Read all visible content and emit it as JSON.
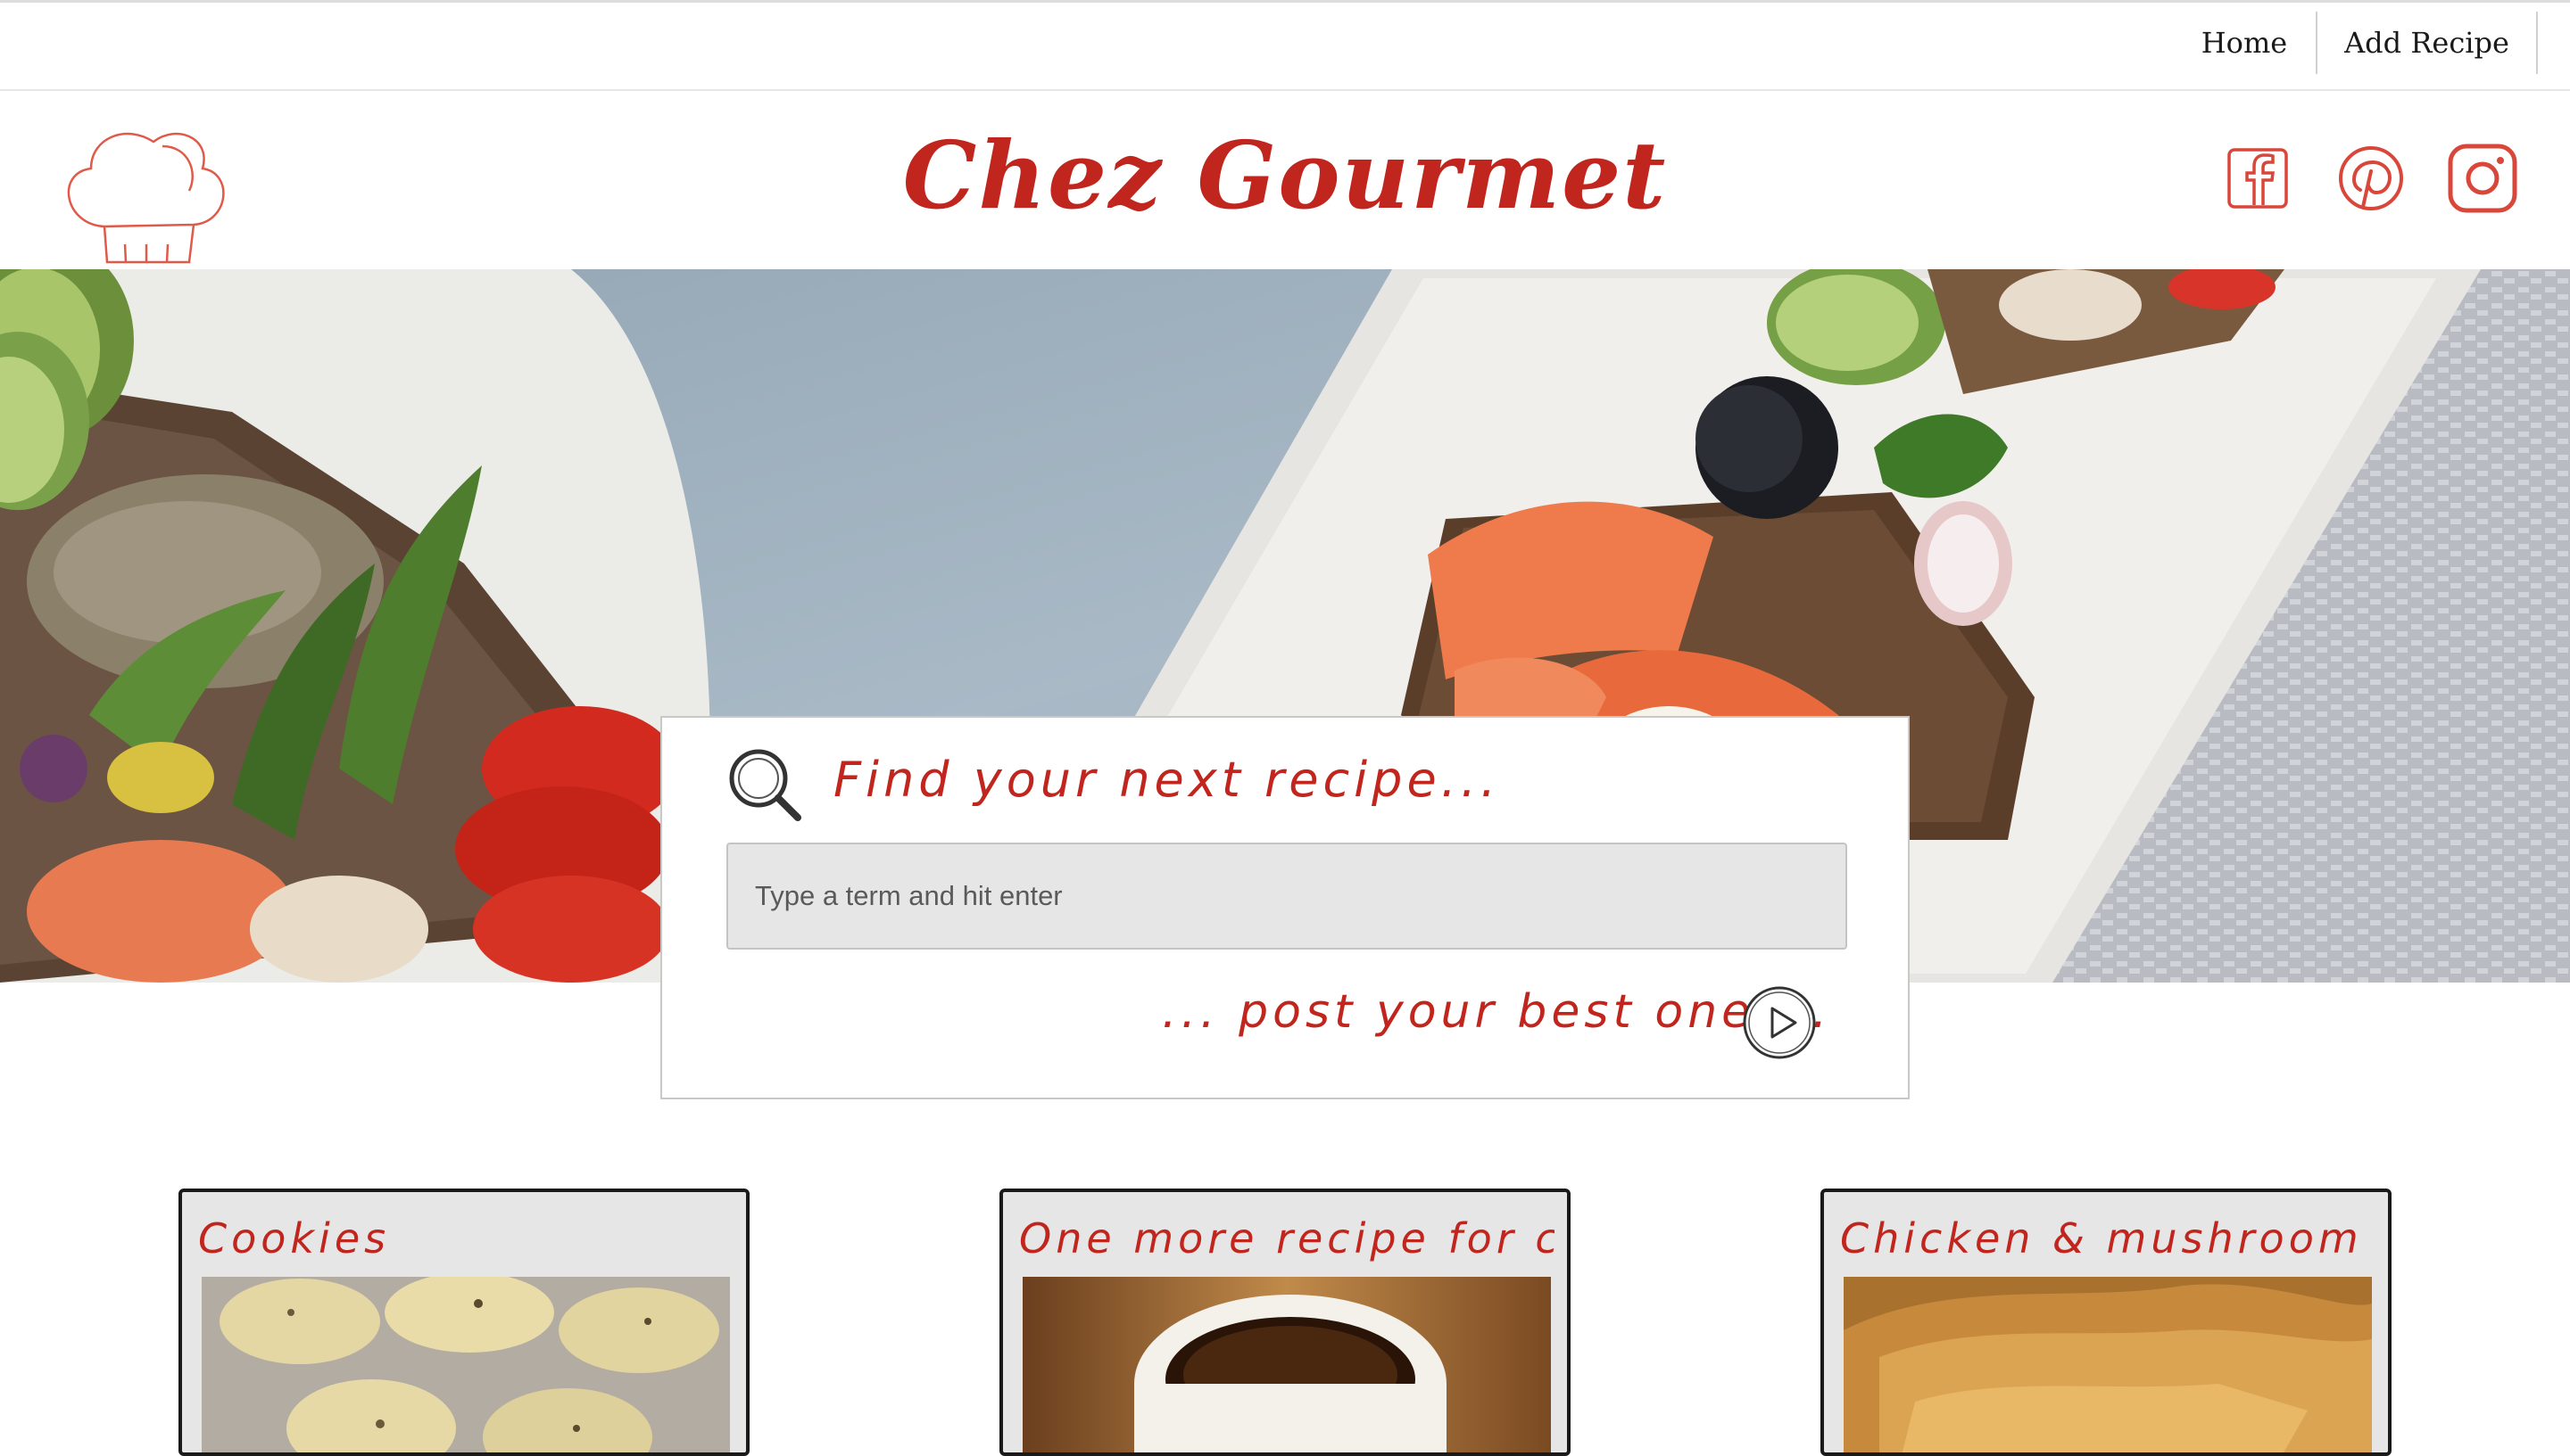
{
  "nav": {
    "home": "Home",
    "add_recipe": "Add Recipe"
  },
  "brand": {
    "title": "Chez Gourmet"
  },
  "social": [
    "facebook-icon",
    "pinterest-icon",
    "instagram-icon"
  ],
  "search": {
    "heading": "Find your next recipe...",
    "placeholder": "Type a term and hit enter",
    "value": "",
    "post_text": "... post your best one ..."
  },
  "recipes": [
    {
      "title": "Cookies"
    },
    {
      "title": "One more recipe for chec..."
    },
    {
      "title": "Chicken & mushroom puf..."
    }
  ],
  "colors": {
    "accent": "#c0261d",
    "card_bg": "#e6e6e6",
    "input_bg": "#e6e6e6"
  }
}
